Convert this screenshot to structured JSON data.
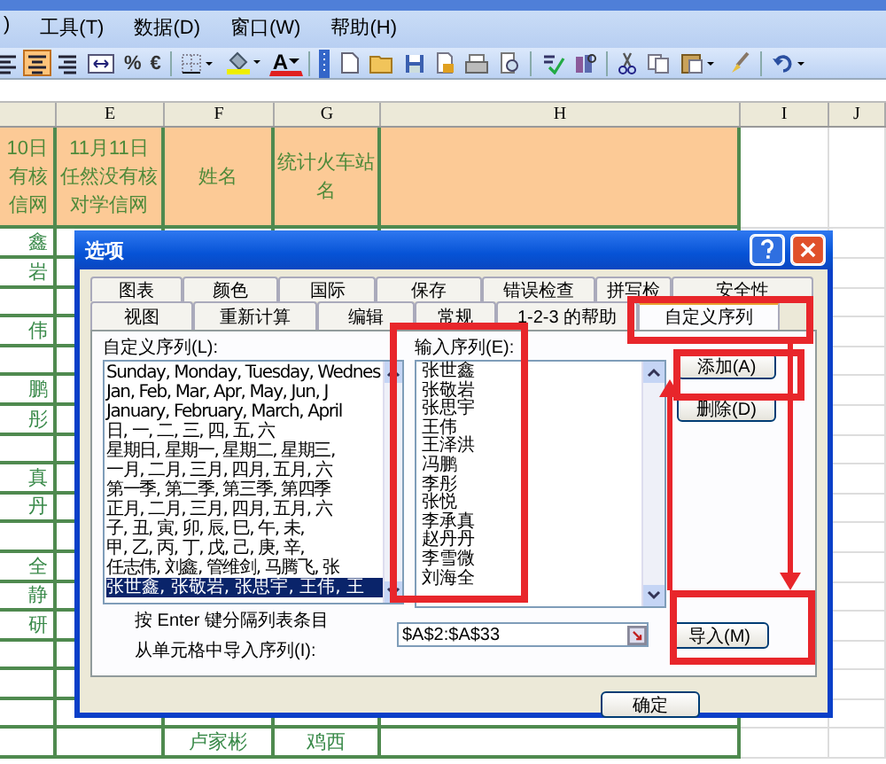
{
  "menu": [
    {
      "label": ")"
    },
    {
      "label": "工具(T)"
    },
    {
      "label": "数据(D)"
    },
    {
      "label": "窗口(W)"
    },
    {
      "label": "帮助(H)"
    }
  ],
  "toolbar_groups": [
    [
      {
        "kind": "align-left",
        "pressed": false
      },
      {
        "kind": "align-center",
        "pressed": true
      },
      {
        "kind": "align-right",
        "pressed": false
      },
      {
        "kind": "merge",
        "pressed": false
      },
      {
        "kind": "text",
        "label": "%",
        "pressed": false
      },
      {
        "kind": "text",
        "label": "€",
        "pressed": false
      }
    ],
    [
      {
        "kind": "borders",
        "pressed": false
      },
      {
        "kind": "fill-color",
        "pressed": false
      },
      {
        "kind": "font-color",
        "label": "A",
        "pressed": false
      }
    ],
    [
      {
        "kind": "grip",
        "pressed": false
      },
      {
        "kind": "new",
        "pressed": false
      },
      {
        "kind": "open",
        "pressed": false
      },
      {
        "kind": "save",
        "pressed": false
      },
      {
        "kind": "permission",
        "pressed": false
      },
      {
        "kind": "print",
        "pressed": false
      },
      {
        "kind": "preview",
        "pressed": false
      }
    ],
    [
      {
        "kind": "spell",
        "pressed": false
      },
      {
        "kind": "research",
        "pressed": false
      }
    ],
    [
      {
        "kind": "cut",
        "pressed": false
      },
      {
        "kind": "copy",
        "pressed": false
      },
      {
        "kind": "paste",
        "pressed": false
      },
      {
        "kind": "painter",
        "pressed": false
      }
    ],
    [
      {
        "kind": "undo",
        "pressed": false
      }
    ]
  ],
  "sheet": {
    "columns": [
      "E",
      "F",
      "G",
      "H",
      "I",
      "J"
    ],
    "header_cells": [
      {
        "lines": [
          "10日",
          "有核",
          "信网"
        ]
      },
      {
        "lines": [
          "11月11日",
          "任然没有核",
          "对学信网"
        ]
      },
      {
        "lines": [
          "姓名"
        ]
      },
      {
        "lines": [
          "统计火车站",
          "名"
        ]
      }
    ],
    "rows": [
      {
        "column_d": "鑫"
      },
      {
        "column_d": "岩"
      },
      {},
      {
        "column_d": "伟"
      },
      {},
      {
        "column_d": "鹏"
      },
      {
        "column_d": "彤"
      },
      {},
      {
        "column_d": "真"
      },
      {
        "column_d": "丹"
      },
      {},
      {
        "column_d": "全"
      },
      {
        "column_d": "静"
      },
      {
        "column_d": "研"
      },
      {},
      {},
      {},
      {
        "name": "卢家彬",
        "station": "鸡西"
      }
    ]
  },
  "dialog": {
    "title": "选项",
    "tab_rows": [
      [
        {
          "label": "图表",
          "selected": false
        },
        {
          "label": "颜色",
          "selected": false
        },
        {
          "label": "国际",
          "selected": false
        },
        {
          "label": "保存",
          "selected": false
        },
        {
          "label": "错误检查",
          "selected": false
        },
        {
          "label": "拼写检",
          "selected": false
        },
        {
          "label": "安全性",
          "selected": false
        }
      ],
      [
        {
          "label": "视图",
          "selected": false
        },
        {
          "label": "重新计算",
          "selected": false
        },
        {
          "label": "编辑",
          "selected": false
        },
        {
          "label": "常规",
          "selected": false
        },
        {
          "label": "1-2-3 的帮助",
          "selected": false
        },
        {
          "label": "自定义序列",
          "selected": true
        }
      ]
    ],
    "lists_label": "自定义序列(L):",
    "lists": [
      {
        "label": "Sunday, Monday, Tuesday, Wednes",
        "selected": false
      },
      {
        "label": "Jan, Feb, Mar, Apr, May, Jun, J",
        "selected": false
      },
      {
        "label": "January, February, March, April",
        "selected": false
      },
      {
        "label": "日, 一, 二, 三, 四, 五, 六",
        "selected": false
      },
      {
        "label": "星期日, 星期一, 星期二, 星期三,",
        "selected": false
      },
      {
        "label": "一月, 二月, 三月, 四月, 五月, 六",
        "selected": false
      },
      {
        "label": "第一季, 第二季, 第三季, 第四季",
        "selected": false
      },
      {
        "label": "正月, 二月, 三月, 四月, 五月, 六",
        "selected": false
      },
      {
        "label": "子, 丑, 寅, 卯, 辰, 巳, 午, 未,",
        "selected": false
      },
      {
        "label": "甲, 乙, 丙, 丁, 戊, 己, 庚, 辛,",
        "selected": false
      },
      {
        "label": "任志伟, 刘鑫, 管维剑, 马腾飞, 张",
        "selected": false
      },
      {
        "label": "张世鑫, 张敬岩, 张思宇, 王伟, 王",
        "selected": true
      }
    ],
    "entries_label": "输入序列(E):",
    "entries": [
      "张世鑫",
      "张敬岩",
      "张思宇",
      "王伟",
      "王泽洪",
      "冯鹏",
      "李彤",
      "张悦",
      "李承真",
      "赵丹丹",
      "李雪微",
      "刘海全"
    ],
    "side_buttons": [
      "添加(A)",
      "删除(D)"
    ],
    "hint": "按 Enter 键分隔列表条目",
    "import_label": "从单元格中导入序列(I):",
    "import_value": "$A$2:$A$33",
    "import_button": "导入(M)",
    "ok_button": "确定"
  },
  "annotations": [
    {
      "kind": "box"
    },
    {
      "kind": "box"
    },
    {
      "kind": "box"
    },
    {
      "kind": "box"
    },
    {
      "kind": "arrow"
    },
    {
      "kind": "arrow"
    }
  ]
}
